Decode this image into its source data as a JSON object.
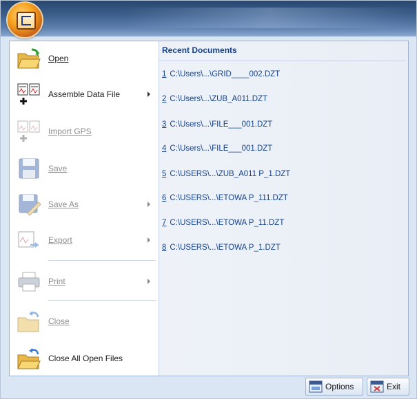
{
  "menu": {
    "items": [
      {
        "label": "Open",
        "icon": "open-folder-icon",
        "enabled": true,
        "submenu": false
      },
      {
        "label": "Assemble Data File",
        "icon": "assemble-data-file-icon",
        "enabled": true,
        "submenu": true
      },
      {
        "label": "Import GPS",
        "icon": "import-gps-icon",
        "enabled": false,
        "submenu": false
      },
      {
        "label": "Save",
        "icon": "floppy-disk-icon",
        "enabled": false,
        "submenu": false
      },
      {
        "label": "Save As",
        "icon": "save-as-icon",
        "enabled": false,
        "submenu": true
      },
      {
        "label": "Export",
        "icon": "export-icon",
        "enabled": false,
        "submenu": true
      },
      {
        "label": "Print",
        "icon": "printer-icon",
        "enabled": false,
        "submenu": true
      },
      {
        "label": "Close",
        "icon": "close-folder-icon",
        "enabled": false,
        "submenu": false
      },
      {
        "label": "Close All Open Files",
        "icon": "close-all-folder-icon",
        "enabled": true,
        "submenu": false
      }
    ]
  },
  "recent": {
    "header": "Recent Documents",
    "items": [
      {
        "num": "1",
        "path": "C:\\Users\\...\\GRID____002.DZT"
      },
      {
        "num": "2",
        "path": "C:\\Users\\...\\ZUB_A011.DZT"
      },
      {
        "num": "3",
        "path": "C:\\Users\\...\\FILE___001.DZT"
      },
      {
        "num": "4",
        "path": "C:\\Users\\...\\FILE___001.DZT"
      },
      {
        "num": "5",
        "path": "C:\\USERS\\...\\ZUB_A011 P_1.DZT"
      },
      {
        "num": "6",
        "path": "C:\\USERS\\...\\ETOWA P_111.DZT"
      },
      {
        "num": "7",
        "path": "C:\\USERS\\...\\ETOWA P_11.DZT"
      },
      {
        "num": "8",
        "path": "C:\\USERS\\...\\ETOWA P_1.DZT"
      }
    ]
  },
  "footer": {
    "options_label": "Options",
    "exit_label": "Exit"
  },
  "colors": {
    "accent": "#15428b",
    "disabled_text": "#8d8d8d"
  }
}
